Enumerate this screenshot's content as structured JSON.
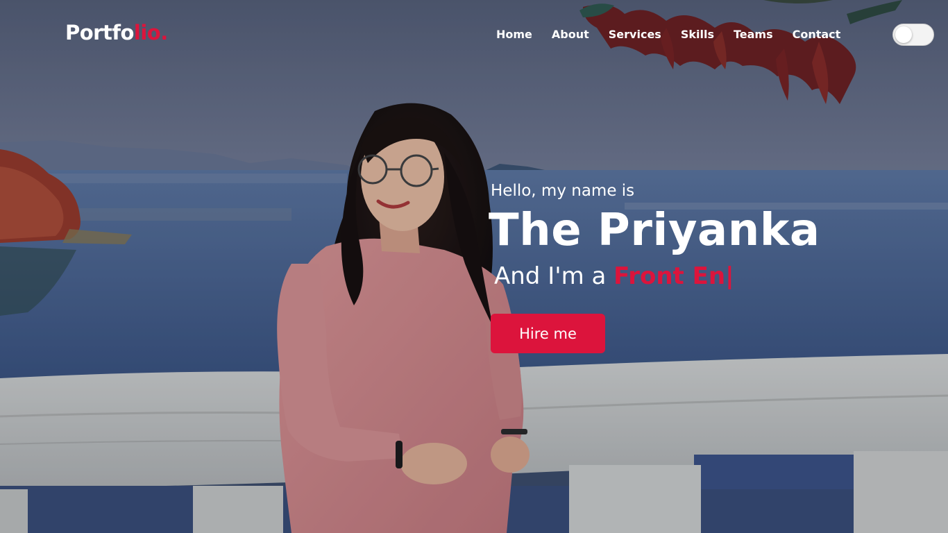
{
  "header": {
    "logo_main": "Portfo",
    "logo_accent": "lio.",
    "nav": [
      {
        "label": "Home"
      },
      {
        "label": "About"
      },
      {
        "label": "Services"
      },
      {
        "label": "Skills"
      },
      {
        "label": "Teams"
      },
      {
        "label": "Contact"
      }
    ],
    "theme_toggle_state": "off"
  },
  "hero": {
    "greeting": "Hello, my name is",
    "name": "The Priyanka",
    "role_prefix": "And I'm a",
    "role_typed": "Front En",
    "cursor": "|",
    "cta_label": "Hire me"
  },
  "colors": {
    "accent": "#dc143c",
    "text": "#ffffff",
    "sky": "#5f6b85",
    "water": "#3f5a86",
    "railing": "#d4d6d6",
    "sweater": "#d98a8c"
  }
}
